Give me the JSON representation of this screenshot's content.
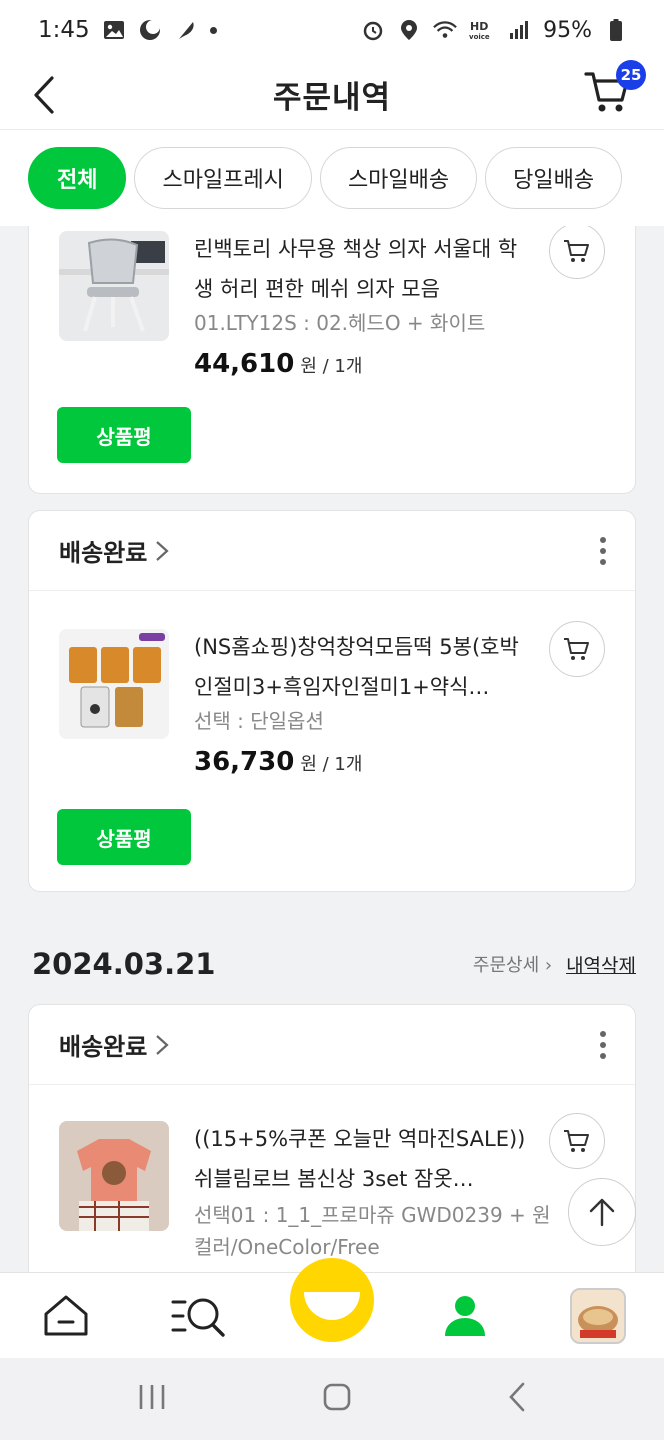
{
  "status_bar": {
    "time": "1:45",
    "battery": "95%"
  },
  "header": {
    "title": "주문내역",
    "cart_count": "25"
  },
  "filters": [
    "전체",
    "스마일프레시",
    "스마일배송",
    "당일배송"
  ],
  "orders": [
    {
      "product": {
        "name": "린백토리 사무용 책상 의자 서울대 학생 허리 편한 메쉬 의자 모음",
        "option": "01.LTY12S : 02.헤드O + 화이트",
        "price": "44,610",
        "unit": "원 / 1개",
        "image": "office-chair"
      },
      "review_label": "상품평"
    },
    {
      "status": "배송완료",
      "product": {
        "name": "(NS홈쇼핑)창억창억모듬떡 5봉(호박인절미3+흑임자인절미1+약식…",
        "option": "선택 : 단일옵션",
        "price": "36,730",
        "unit": "원 / 1개",
        "image": "rice-cake-packs"
      },
      "review_label": "상품평"
    }
  ],
  "date_group": {
    "date": "2024.03.21",
    "detail_label": "주문상세 ›",
    "delete_label": "내역삭제"
  },
  "order3": {
    "status": "배송완료",
    "product": {
      "name": "((15+5%쿠폰 오늘만 역마진SALE)) 쉬블림로브 봄신상 3set 잠옷…",
      "option": "선택01 : 1_1_프로마쥬 GWD0239 + 원컬러/OneColor/Free",
      "image": "pajama-set"
    }
  },
  "bottom_nav": [
    "home-icon",
    "search-menu-icon",
    "smile-icon",
    "my-page-icon",
    "recent-product-thumb"
  ],
  "colors": {
    "accent": "#00c73c",
    "badge": "#1a3ee8",
    "smile": "#ffd600"
  }
}
